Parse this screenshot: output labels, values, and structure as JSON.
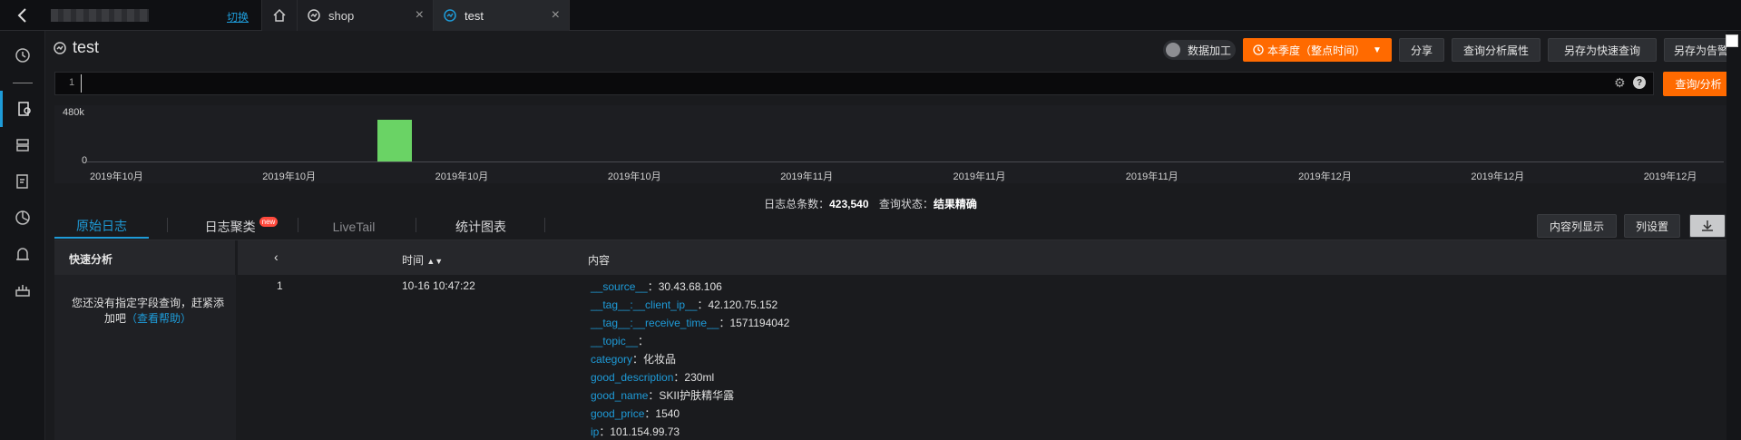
{
  "topbar": {
    "switch_label": "切换",
    "tabs": [
      {
        "label": "shop"
      },
      {
        "label": "test"
      }
    ]
  },
  "header": {
    "title": "test",
    "toggle_label": "数据加工",
    "time_range": "本季度（整点时间）",
    "share": "分享",
    "query_props": "查询分析属性",
    "save_quick": "另存为快速查询",
    "save_alert": "另存为告警"
  },
  "query": {
    "line_number": "1",
    "value": "",
    "search_label": "查询/分析"
  },
  "histogram": {
    "y_ticks": [
      "480k",
      "0"
    ],
    "x_ticks": [
      "2019年10月",
      "2019年10月",
      "2019年10月",
      "2019年10月",
      "2019年11月",
      "2019年11月",
      "2019年11月",
      "2019年12月",
      "2019年12月",
      "2019年12月"
    ],
    "bar_fraction": 0.88,
    "bar_color": "#6ad365"
  },
  "summary": {
    "total_label": "日志总条数：",
    "total_value": "423,540",
    "status_label": "查询状态：",
    "status_value": "结果精确"
  },
  "result_tabs": {
    "raw": "原始日志",
    "cluster": "日志聚类",
    "cluster_badge": "new",
    "livetail": "LiveTail",
    "chart": "统计图表",
    "content_col": "内容列显示",
    "col_settings": "列设置"
  },
  "quick": {
    "header": "快速分析",
    "message": "您还没有指定字段查询，赶紧添加吧",
    "help": "（查看帮助）"
  },
  "table": {
    "headers": {
      "time": "时间",
      "content": "内容"
    },
    "row": {
      "index": "1",
      "time": "10-16 10:47:22",
      "fields": [
        {
          "k": "__source__",
          "v": "30.43.68.106"
        },
        {
          "k": "__tag__:__client_ip__",
          "v": "42.120.75.152"
        },
        {
          "k": "__tag__:__receive_time__",
          "v": "1571194042"
        },
        {
          "k": "__topic__",
          "v": ""
        },
        {
          "k": "category",
          "v": "化妆品"
        },
        {
          "k": "good_description",
          "v": "230ml"
        },
        {
          "k": "good_name",
          "v": "SKII护肤精华露"
        },
        {
          "k": "good_price",
          "v": "1540"
        },
        {
          "k": "ip",
          "v": "101.154.99.73"
        }
      ]
    }
  },
  "colors": {
    "accent": "#1e9bd8",
    "primary": "#ff6a00"
  }
}
